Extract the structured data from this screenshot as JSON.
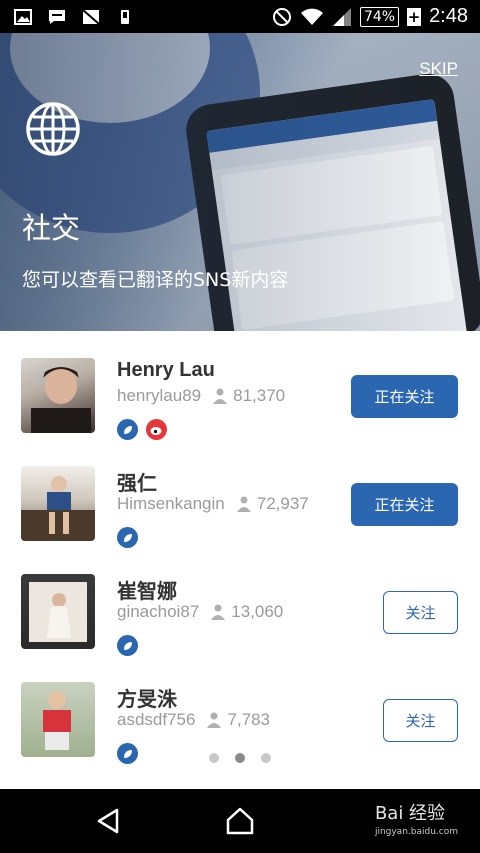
{
  "status_bar": {
    "battery": "74%",
    "time": "2:48"
  },
  "hero": {
    "skip_label": "SKIP",
    "title": "社交",
    "subtitle": "您可以查看已翻译的SNS新内容"
  },
  "users": [
    {
      "name": "Henry Lau",
      "handle": "henrylau89",
      "followers": "81,370",
      "button": "正在关注",
      "following": true,
      "badges": [
        "blue",
        "red"
      ]
    },
    {
      "name": "强仁",
      "handle": "Himsenkangin",
      "followers": "72,937",
      "button": "正在关注",
      "following": true,
      "badges": [
        "blue"
      ]
    },
    {
      "name": "崔智娜",
      "handle": "ginachoi87",
      "followers": "13,060",
      "button": "关注",
      "following": false,
      "badges": [
        "blue"
      ]
    },
    {
      "name": "方旻洙",
      "handle": "asdsdf756",
      "followers": "7,783",
      "button": "关注",
      "following": false,
      "badges": [
        "blue"
      ]
    }
  ],
  "pager": {
    "count": 3,
    "active_index": 1
  },
  "watermark": {
    "text": "Bai 经验",
    "sub": "jingyan.baidu.com"
  },
  "colors": {
    "accent": "#2b67b1",
    "weibo": "#e5373b"
  }
}
